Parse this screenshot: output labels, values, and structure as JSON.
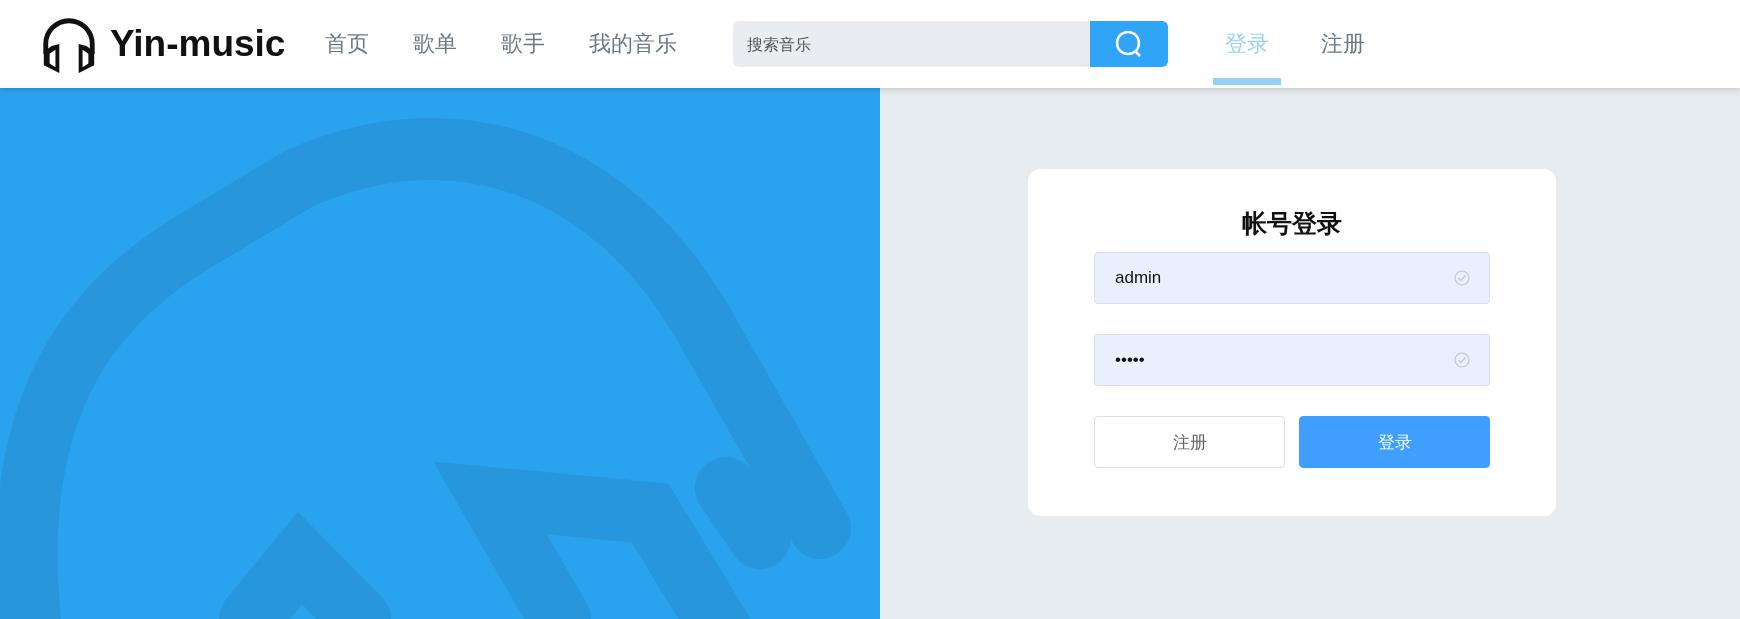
{
  "header": {
    "logo": "Yin-music",
    "nav": [
      {
        "label": "首页",
        "selected": false
      },
      {
        "label": "歌单",
        "selected": false
      },
      {
        "label": "歌手",
        "selected": false
      },
      {
        "label": "我的音乐",
        "selected": false
      }
    ],
    "search": {
      "placeholder": "搜索音乐"
    },
    "account": [
      {
        "label": "登录",
        "selected": true
      },
      {
        "label": "注册",
        "selected": false
      }
    ]
  },
  "login": {
    "title": "帐号登录",
    "fields": [
      {
        "value": "admin",
        "valid": true
      },
      {
        "value": "•••••",
        "valid": true
      }
    ],
    "buttons": [
      {
        "label": "注册",
        "kind": "secondary"
      },
      {
        "label": "登录",
        "kind": "primary"
      }
    ]
  }
}
